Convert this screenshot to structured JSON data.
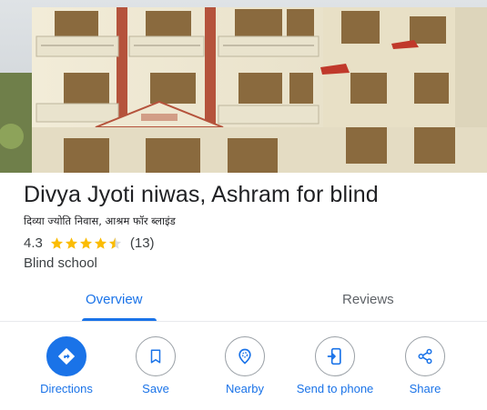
{
  "place": {
    "name": "Divya Jyoti niwas, Ashram for blind",
    "local_name": "दिव्या ज्योति निवास, आश्रम फॉर ब्लाइंड",
    "rating": "4.3",
    "rating_stars_filled": 4.3,
    "review_count": "(13)",
    "category": "Blind school"
  },
  "tabs": {
    "overview": "Overview",
    "reviews": "Reviews",
    "active": "overview"
  },
  "actions": {
    "directions": "Directions",
    "save": "Save",
    "nearby": "Nearby",
    "send_to_phone": "Send to phone",
    "share": "Share"
  },
  "colors": {
    "accent": "#1a73e8",
    "star": "#fbbc04",
    "text_primary": "#202124",
    "text_secondary": "#5f6368"
  },
  "icons": {
    "directions": "directions-icon",
    "save": "bookmark-icon",
    "nearby": "nearby-icon",
    "send_to_phone": "send-to-phone-icon",
    "share": "share-icon"
  }
}
